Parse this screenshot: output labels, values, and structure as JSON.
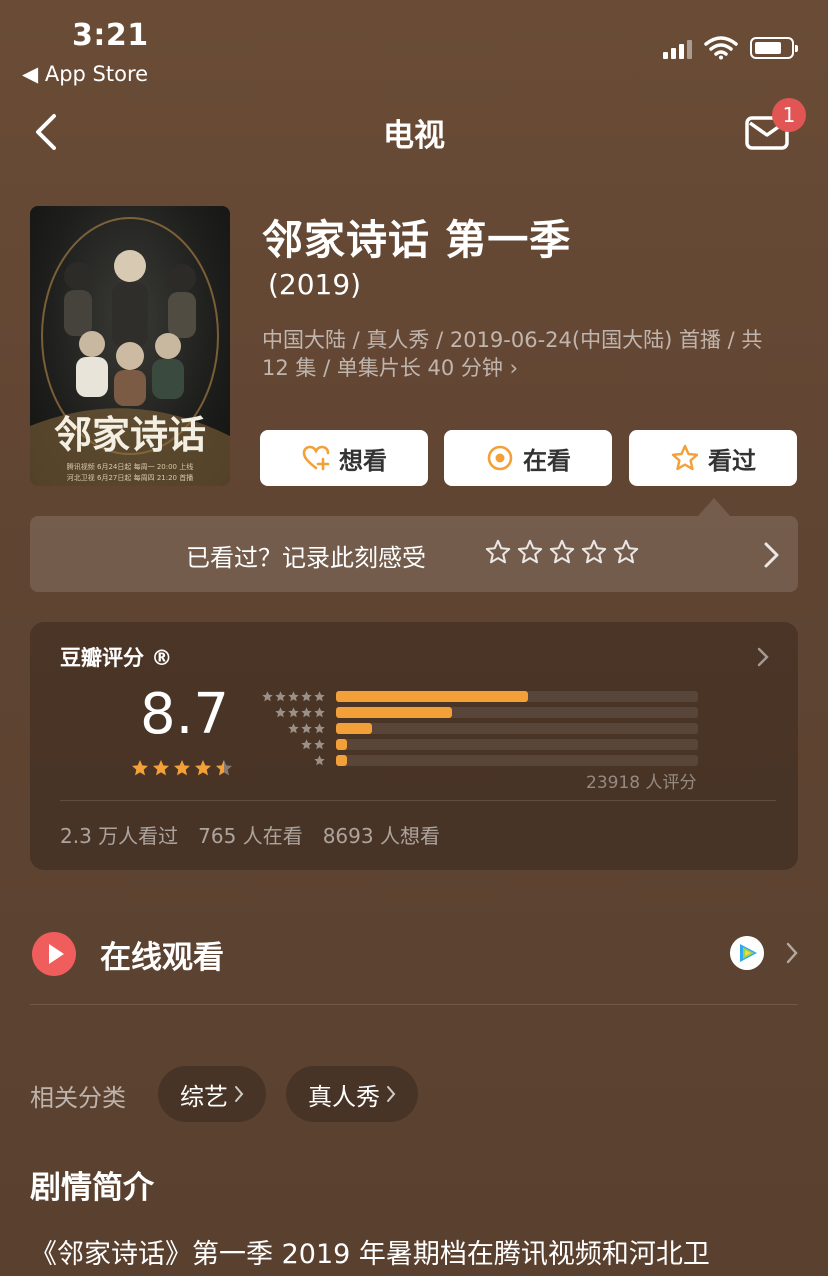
{
  "status_bar": {
    "time": "3:21",
    "back_app": "◀ App Store",
    "battery_level": 0.75
  },
  "nav": {
    "title": "电视",
    "mail_badge": "1"
  },
  "show": {
    "title": "邻家诗话 第一季",
    "year": "(2019)",
    "meta": "中国大陆 / 真人秀 / 2019-06-24(中国大陆) 首播 / 共 12 集 / 单集片长 40 分钟 ›",
    "poster": {
      "title": "邻家诗话",
      "line1": "腾讯视频 6月24日起 每周一 20:00 上线",
      "line2": "河北卫视 6月27日起 每周四 21:20 首播"
    }
  },
  "actions": {
    "want_label": "想看",
    "watching_label": "在看",
    "watched_label": "看过"
  },
  "rate_prompt": {
    "text": "已看过？记录此刻感受",
    "stars_count": 5
  },
  "douban": {
    "label": "豆瓣评分 ®",
    "score": "8.7",
    "score_stars": 4.5,
    "distribution": [
      {
        "stars": 5,
        "fraction": 0.53
      },
      {
        "stars": 4,
        "fraction": 0.32
      },
      {
        "stars": 3,
        "fraction": 0.1
      },
      {
        "stars": 2,
        "fraction": 0.03
      },
      {
        "stars": 1,
        "fraction": 0.03
      }
    ],
    "votes": "23918 人评分",
    "watched": "2.3 万人看过",
    "watching": "765 人在看",
    "want": "8693 人想看"
  },
  "online": {
    "label": "在线观看"
  },
  "categories": {
    "label": "相关分类",
    "items": [
      "综艺",
      "真人秀"
    ]
  },
  "synopsis": {
    "title": "剧情简介",
    "text": "《邻家诗话》第一季 2019 年暑期档在腾讯视频和河北卫"
  },
  "colors": {
    "accent": "#f2a037",
    "badge": "#e25555",
    "play": "#ef5d5d"
  }
}
